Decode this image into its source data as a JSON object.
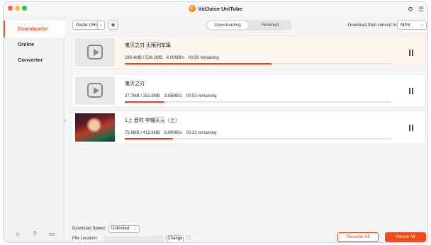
{
  "app": {
    "title": "VidJuice UniTube"
  },
  "sidebar": {
    "items": [
      {
        "label": "Downloader",
        "active": true
      },
      {
        "label": "Online",
        "active": false
      },
      {
        "label": "Converter",
        "active": false
      }
    ],
    "bottom_icons": [
      "bulb-icon",
      "help-icon",
      "feedback-icon"
    ]
  },
  "toolbar": {
    "paste_label": "Paste URL",
    "tabs": [
      {
        "label": "Downloading",
        "active": true
      },
      {
        "label": "Finished",
        "active": false
      }
    ],
    "convert_label": "Download then convert to:",
    "format_value": "MP4"
  },
  "downloads": [
    {
      "title": "鬼灭之刃 无限列车篇",
      "size": "289.4MB / 526.2MB",
      "speed": "4.00MB/s",
      "remaining": "00:56 remaining",
      "progress": 0.55,
      "thumb": "placeholder"
    },
    {
      "title": "鬼灭之刃",
      "size": "37.7MB / 252.9MB",
      "speed": "3.85MB/s",
      "remaining": "00:53 remaining",
      "progress": 0.15,
      "thumb": "placeholder"
    },
    {
      "title": "1上 音柱 宇髓天元（上）",
      "size": "75.6MB / 415.6MB",
      "speed": "9.80MB/s",
      "remaining": "00:33 remaining",
      "progress": 0.18,
      "thumb": "art"
    }
  ],
  "footer": {
    "speed_label": "Download Speed:",
    "speed_value": "Unlimited",
    "location_label": "File Location:",
    "change_label": "Change",
    "resume_label": "Resume All",
    "pause_label": "Pause All"
  },
  "colors": {
    "accent": "#ee4d1e",
    "progress": "#e8421c"
  }
}
